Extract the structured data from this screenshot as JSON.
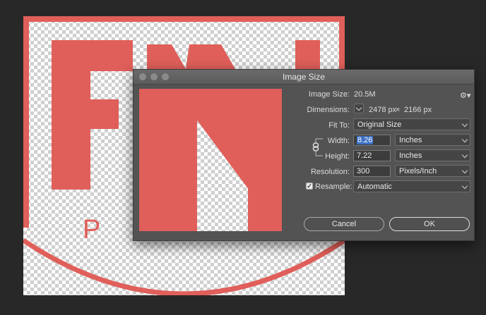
{
  "dialog": {
    "title": "Image Size",
    "image_size_label": "Image Size:",
    "image_size_value": "20.5M",
    "gear_icon": "gear-icon",
    "dimensions_label": "Dimensions:",
    "dimensions_width": "2478 px",
    "dimensions_times": "×",
    "dimensions_height": "2166 px",
    "fit_to_label": "Fit To:",
    "fit_to_value": "Original Size",
    "width_label": "Width:",
    "width_value": "8.26",
    "width_unit": "Inches",
    "height_label": "Height:",
    "height_value": "7.22",
    "height_unit": "Inches",
    "resolution_label": "Resolution:",
    "resolution_value": "300",
    "resolution_unit": "Pixels/Inch",
    "resample_label": "Resample:",
    "resample_checked": true,
    "resample_value": "Automatic",
    "cancel_label": "Cancel",
    "ok_label": "OK"
  },
  "canvas": {
    "logo_fragment_text": "P C",
    "logo_color": "#e05f5a"
  }
}
